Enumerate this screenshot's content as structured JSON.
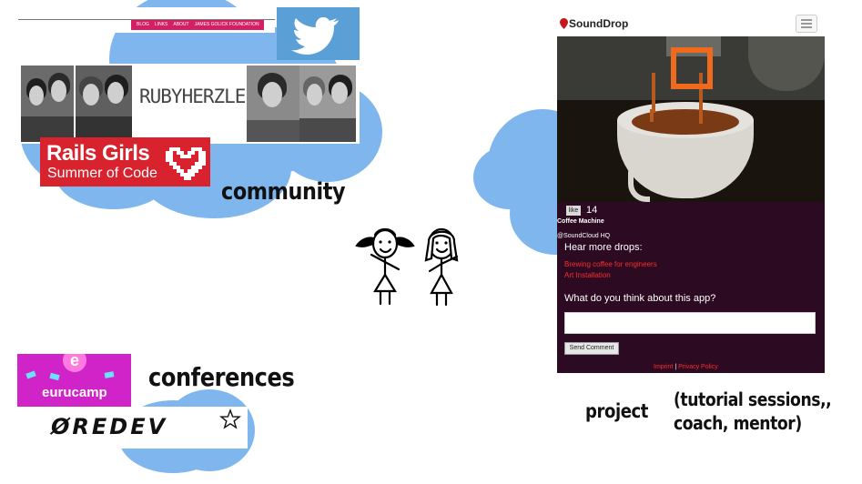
{
  "community": {
    "caption": "community",
    "blog_nav": [
      "BLOG",
      "LINKS",
      "ABOUT",
      "JAMES GOLICK FOUNDATION"
    ],
    "rubyherzlein": "RUBYHERZLEIN",
    "railsgirls": {
      "line1": "Rails Girls",
      "line2": "Summer of Code"
    },
    "twitter_icon": "twitter-bird-icon"
  },
  "conferences": {
    "caption": "conferences",
    "eurucamp": "eurucamp",
    "oredev": "ØREDEV",
    "star_icon": "star-outline-icon"
  },
  "project": {
    "caption": "project",
    "note": "(tutorial sessions,, coach, mentor)",
    "app": {
      "brand": "SoundDrop",
      "like_label": "like",
      "like_count": "14",
      "drop_title": "Coffee Machine",
      "drop_location": "@SoundCloud HQ",
      "hear_more": "Hear more drops:",
      "links": [
        "Brewing coffee for engineers",
        "Art Installation"
      ],
      "question": "What do you think about this app?",
      "send_label": "Send Comment",
      "footer_imprint": "Imprint",
      "footer_sep": "|",
      "footer_privacy": "Privacy Policy"
    }
  },
  "colors": {
    "cloud": "#7fb6ee",
    "railsgirls": "#d8232f",
    "twitter": "#5a9fd6",
    "eurucamp": "#d024c8",
    "app_panel": "#2b0a22",
    "app_link": "#ff2b2b"
  }
}
